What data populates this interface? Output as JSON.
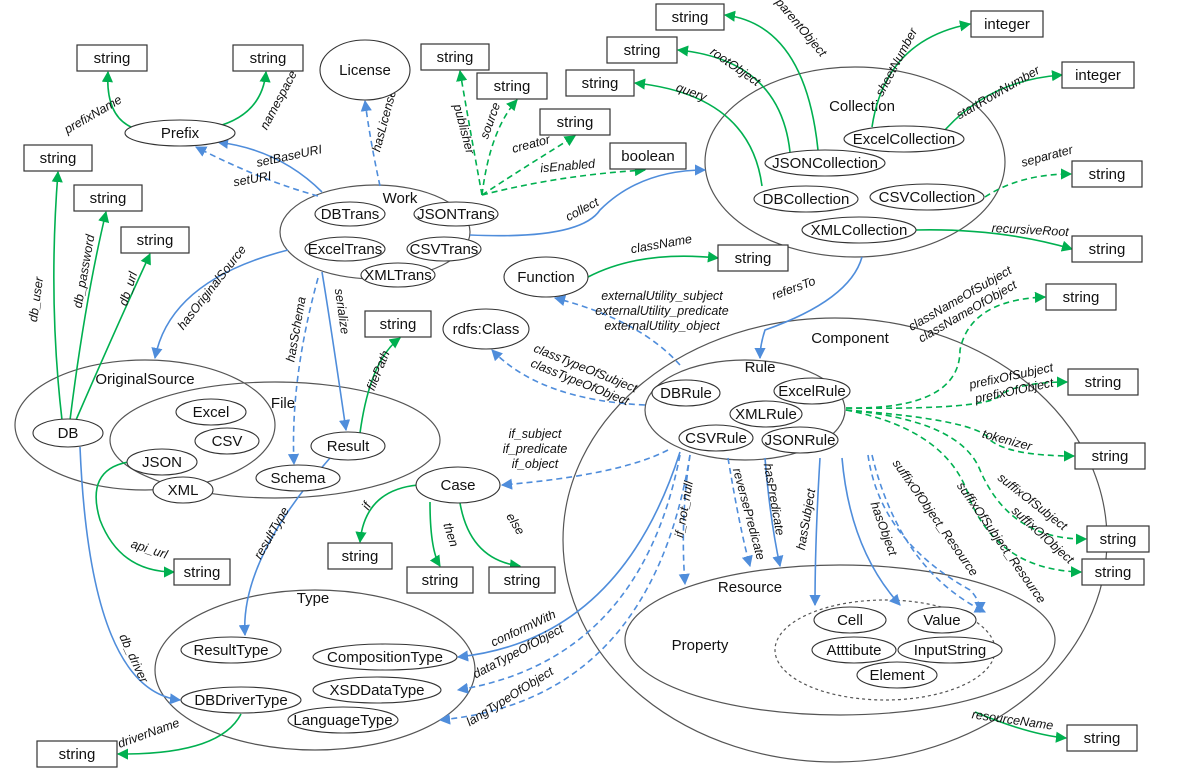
{
  "colors": {
    "green": "#00b050",
    "blue": "#4f8ddb",
    "stroke": "#555555"
  },
  "nodes": {
    "s_prefixname": "string",
    "s_namespace": "string",
    "s_dbuser": "string",
    "s_dbpass": "string",
    "s_dburl": "string",
    "s_publisher": "string",
    "s_source": "string",
    "s_creator": "string",
    "boolean": "boolean",
    "s_query": "string",
    "s_root": "string",
    "s_parent": "string",
    "int_sheet": "integer",
    "int_startrow": "integer",
    "s_separater": "string",
    "s_recursive": "string",
    "s_classname": "string",
    "s_filepath": "string",
    "s_classnamesubj": "string",
    "s_prefixsubj": "string",
    "s_tokenizer": "string",
    "s_suffixsubj": "string",
    "s_suffixobj": "string",
    "s_api": "string",
    "s_if": "string",
    "s_then": "string",
    "s_else": "string",
    "s_resourcename": "string",
    "s_drivername": "string",
    "prefix": "Prefix",
    "license": "License",
    "work": "Work",
    "dbtrans": "DBTrans",
    "jsontrans": "JSONTrans",
    "exceltrans": "ExcelTrans",
    "csvtrans": "CSVTrans",
    "xmltrans": "XMLTrans",
    "collection": "Collection",
    "excelcollection": "ExcelCollection",
    "jsoncollection": "JSONCollection",
    "dbcollection": "DBCollection",
    "csvcollection": "CSVCollection",
    "xmlcollection": "XMLCollection",
    "function": "Function",
    "rdfsclass": "rdfs:Class",
    "originalsource": "OriginalSource",
    "db": "DB",
    "file": "File",
    "excel": "Excel",
    "csv": "CSV",
    "json": "JSON",
    "xml": "XML",
    "schema": "Schema",
    "result": "Result",
    "case": "Case",
    "component": "Component",
    "rule": "Rule",
    "dbrule": "DBRule",
    "excelrule": "ExcelRule",
    "xmlrule": "XMLRule",
    "csvrule": "CSVRule",
    "jsonrule": "JSONRule",
    "resource": "Resource",
    "property": "Property",
    "resgroup": "",
    "cell": "Cell",
    "value": "Value",
    "atttibute": "Atttibute",
    "inputstring": "InputString",
    "element": "Element",
    "type": "Type",
    "resulttype": "ResultType",
    "compositiontype": "CompositionType",
    "xsddatatype": "XSDDataType",
    "dbdrivertype": "DBDriverType",
    "languagetype": "LanguageType"
  },
  "edges": [
    {
      "id": "prefixName",
      "label": [
        "prefixName"
      ],
      "style": "green-solid"
    },
    {
      "id": "namespace",
      "label": [
        "namespace"
      ],
      "style": "green-solid"
    },
    {
      "id": "db_user",
      "label": [
        "db_user"
      ],
      "style": "green-solid"
    },
    {
      "id": "db_password",
      "label": [
        "db_password"
      ],
      "style": "green-solid"
    },
    {
      "id": "db_url",
      "label": [
        "db_url"
      ],
      "style": "green-solid"
    },
    {
      "id": "api_url",
      "label": [
        "api_url"
      ],
      "style": "green-solid"
    },
    {
      "id": "filePath",
      "label": [
        "filePath"
      ],
      "style": "green-solid"
    },
    {
      "id": "className",
      "label": [
        "className"
      ],
      "style": "green-solid"
    },
    {
      "id": "query",
      "label": [
        "query"
      ],
      "style": "green-solid"
    },
    {
      "id": "rootObject",
      "label": [
        "rootObject"
      ],
      "style": "green-solid"
    },
    {
      "id": "parentObject",
      "label": [
        "parentObject"
      ],
      "style": "green-solid"
    },
    {
      "id": "sheetNumber",
      "label": [
        "sheetNumber"
      ],
      "style": "green-solid"
    },
    {
      "id": "startRowNumber",
      "label": [
        "startRowNumber"
      ],
      "style": "green-solid"
    },
    {
      "id": "recursiveRoot",
      "label": [
        "recursiveRoot"
      ],
      "style": "green-solid"
    },
    {
      "id": "if",
      "label": [
        "if"
      ],
      "style": "green-solid"
    },
    {
      "id": "then",
      "label": [
        "then"
      ],
      "style": "green-solid"
    },
    {
      "id": "else",
      "label": [
        "else"
      ],
      "style": "green-solid"
    },
    {
      "id": "resourceName",
      "label": [
        "resourceName"
      ],
      "style": "green-solid"
    },
    {
      "id": "driverName",
      "label": [
        "driverName"
      ],
      "style": "green-solid"
    },
    {
      "id": "publisher",
      "label": [
        "publisher"
      ],
      "style": "green-dashed"
    },
    {
      "id": "source",
      "label": [
        "source"
      ],
      "style": "green-dashed"
    },
    {
      "id": "creator",
      "label": [
        "creator"
      ],
      "style": "green-dashed"
    },
    {
      "id": "isEnabled",
      "label": [
        "isEnabled"
      ],
      "style": "green-dashed"
    },
    {
      "id": "separater",
      "label": [
        "separater"
      ],
      "style": "green-dashed"
    },
    {
      "id": "classNameOf",
      "label": [
        "classNameOfSubject",
        "classNameOfObject"
      ],
      "style": "green-dashed"
    },
    {
      "id": "prefixOf",
      "label": [
        "prefixOfSubject",
        "prefixOfObject"
      ],
      "style": "green-dashed"
    },
    {
      "id": "tokenizer",
      "label": [
        "tokenizer"
      ],
      "style": "green-dashed"
    },
    {
      "id": "suffixOfSubject",
      "label": [
        "suffixOfSubject"
      ],
      "style": "green-dashed"
    },
    {
      "id": "suffixOfObject",
      "label": [
        "suffixOfObject"
      ],
      "style": "green-dashed"
    },
    {
      "id": "setBaseURI",
      "label": [
        "setBaseURI"
      ],
      "style": "blue-solid"
    },
    {
      "id": "collect",
      "label": [
        "collect"
      ],
      "style": "blue-solid"
    },
    {
      "id": "hasOriginalSource",
      "label": [
        "hasOriginalSource"
      ],
      "style": "blue-solid"
    },
    {
      "id": "serialize",
      "label": [
        "serialize"
      ],
      "style": "blue-solid"
    },
    {
      "id": "refersTo",
      "label": [
        "refersTo"
      ],
      "style": "blue-solid"
    },
    {
      "id": "resultType",
      "label": [
        "resultType"
      ],
      "style": "blue-solid"
    },
    {
      "id": "db_driver",
      "label": [
        "db_driver"
      ],
      "style": "blue-solid"
    },
    {
      "id": "conformWith",
      "label": [
        "conformWith"
      ],
      "style": "blue-solid"
    },
    {
      "id": "hasPredicate",
      "label": [
        "hasPredicate"
      ],
      "style": "blue-solid"
    },
    {
      "id": "hasSubject",
      "label": [
        "hasSubject"
      ],
      "style": "blue-solid"
    },
    {
      "id": "hasObject",
      "label": [
        "hasObject"
      ],
      "style": "blue-solid"
    },
    {
      "id": "hasLicense",
      "label": [
        "hasLicense"
      ],
      "style": "blue-dashed"
    },
    {
      "id": "setURI",
      "label": [
        "setURI"
      ],
      "style": "blue-dashed"
    },
    {
      "id": "hasSchema",
      "label": [
        "hasSchema"
      ],
      "style": "blue-dashed"
    },
    {
      "id": "externalUtility",
      "label": [
        "externalUtility_subject",
        "externalUtility_predicate",
        "externalUtility_object"
      ],
      "style": "blue-dashed"
    },
    {
      "id": "classType",
      "label": [
        "classTypeOfSubject",
        "classTypeOfObject"
      ],
      "style": "blue-dashed"
    },
    {
      "id": "ifCase",
      "label": [
        "if_subject",
        "if_predicate",
        "if_object"
      ],
      "style": "blue-dashed"
    },
    {
      "id": "if_not_null",
      "label": [
        "if_not_null"
      ],
      "style": "blue-dashed"
    },
    {
      "id": "reversePredicate",
      "label": [
        "reversePredicate"
      ],
      "style": "blue-dashed"
    },
    {
      "id": "suffixOfObject_Resource",
      "label": [
        "suffixOfObject_Resource"
      ],
      "style": "blue-dashed"
    },
    {
      "id": "suffixOfSubject_Resource",
      "label": [
        "suffixOfSubject_Resource"
      ],
      "style": "blue-dashed"
    },
    {
      "id": "dataTypeOfObject",
      "label": [
        "dataTypeOfObject"
      ],
      "style": "blue-dashed"
    },
    {
      "id": "langTypeOfObject",
      "label": [
        "langTypeOfObject"
      ],
      "style": "blue-dashed"
    }
  ]
}
